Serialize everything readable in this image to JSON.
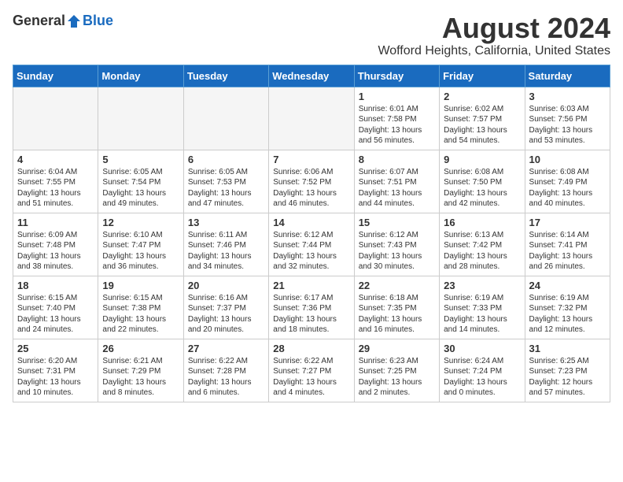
{
  "header": {
    "logo": {
      "general": "General",
      "blue": "Blue"
    },
    "month": "August 2024",
    "location": "Wofford Heights, California, United States"
  },
  "columns": [
    "Sunday",
    "Monday",
    "Tuesday",
    "Wednesday",
    "Thursday",
    "Friday",
    "Saturday"
  ],
  "weeks": [
    [
      {
        "day": "",
        "info": ""
      },
      {
        "day": "",
        "info": ""
      },
      {
        "day": "",
        "info": ""
      },
      {
        "day": "",
        "info": ""
      },
      {
        "day": "1",
        "info": "Sunrise: 6:01 AM\nSunset: 7:58 PM\nDaylight: 13 hours\nand 56 minutes."
      },
      {
        "day": "2",
        "info": "Sunrise: 6:02 AM\nSunset: 7:57 PM\nDaylight: 13 hours\nand 54 minutes."
      },
      {
        "day": "3",
        "info": "Sunrise: 6:03 AM\nSunset: 7:56 PM\nDaylight: 13 hours\nand 53 minutes."
      }
    ],
    [
      {
        "day": "4",
        "info": "Sunrise: 6:04 AM\nSunset: 7:55 PM\nDaylight: 13 hours\nand 51 minutes."
      },
      {
        "day": "5",
        "info": "Sunrise: 6:05 AM\nSunset: 7:54 PM\nDaylight: 13 hours\nand 49 minutes."
      },
      {
        "day": "6",
        "info": "Sunrise: 6:05 AM\nSunset: 7:53 PM\nDaylight: 13 hours\nand 47 minutes."
      },
      {
        "day": "7",
        "info": "Sunrise: 6:06 AM\nSunset: 7:52 PM\nDaylight: 13 hours\nand 46 minutes."
      },
      {
        "day": "8",
        "info": "Sunrise: 6:07 AM\nSunset: 7:51 PM\nDaylight: 13 hours\nand 44 minutes."
      },
      {
        "day": "9",
        "info": "Sunrise: 6:08 AM\nSunset: 7:50 PM\nDaylight: 13 hours\nand 42 minutes."
      },
      {
        "day": "10",
        "info": "Sunrise: 6:08 AM\nSunset: 7:49 PM\nDaylight: 13 hours\nand 40 minutes."
      }
    ],
    [
      {
        "day": "11",
        "info": "Sunrise: 6:09 AM\nSunset: 7:48 PM\nDaylight: 13 hours\nand 38 minutes."
      },
      {
        "day": "12",
        "info": "Sunrise: 6:10 AM\nSunset: 7:47 PM\nDaylight: 13 hours\nand 36 minutes."
      },
      {
        "day": "13",
        "info": "Sunrise: 6:11 AM\nSunset: 7:46 PM\nDaylight: 13 hours\nand 34 minutes."
      },
      {
        "day": "14",
        "info": "Sunrise: 6:12 AM\nSunset: 7:44 PM\nDaylight: 13 hours\nand 32 minutes."
      },
      {
        "day": "15",
        "info": "Sunrise: 6:12 AM\nSunset: 7:43 PM\nDaylight: 13 hours\nand 30 minutes."
      },
      {
        "day": "16",
        "info": "Sunrise: 6:13 AM\nSunset: 7:42 PM\nDaylight: 13 hours\nand 28 minutes."
      },
      {
        "day": "17",
        "info": "Sunrise: 6:14 AM\nSunset: 7:41 PM\nDaylight: 13 hours\nand 26 minutes."
      }
    ],
    [
      {
        "day": "18",
        "info": "Sunrise: 6:15 AM\nSunset: 7:40 PM\nDaylight: 13 hours\nand 24 minutes."
      },
      {
        "day": "19",
        "info": "Sunrise: 6:15 AM\nSunset: 7:38 PM\nDaylight: 13 hours\nand 22 minutes."
      },
      {
        "day": "20",
        "info": "Sunrise: 6:16 AM\nSunset: 7:37 PM\nDaylight: 13 hours\nand 20 minutes."
      },
      {
        "day": "21",
        "info": "Sunrise: 6:17 AM\nSunset: 7:36 PM\nDaylight: 13 hours\nand 18 minutes."
      },
      {
        "day": "22",
        "info": "Sunrise: 6:18 AM\nSunset: 7:35 PM\nDaylight: 13 hours\nand 16 minutes."
      },
      {
        "day": "23",
        "info": "Sunrise: 6:19 AM\nSunset: 7:33 PM\nDaylight: 13 hours\nand 14 minutes."
      },
      {
        "day": "24",
        "info": "Sunrise: 6:19 AM\nSunset: 7:32 PM\nDaylight: 13 hours\nand 12 minutes."
      }
    ],
    [
      {
        "day": "25",
        "info": "Sunrise: 6:20 AM\nSunset: 7:31 PM\nDaylight: 13 hours\nand 10 minutes."
      },
      {
        "day": "26",
        "info": "Sunrise: 6:21 AM\nSunset: 7:29 PM\nDaylight: 13 hours\nand 8 minutes."
      },
      {
        "day": "27",
        "info": "Sunrise: 6:22 AM\nSunset: 7:28 PM\nDaylight: 13 hours\nand 6 minutes."
      },
      {
        "day": "28",
        "info": "Sunrise: 6:22 AM\nSunset: 7:27 PM\nDaylight: 13 hours\nand 4 minutes."
      },
      {
        "day": "29",
        "info": "Sunrise: 6:23 AM\nSunset: 7:25 PM\nDaylight: 13 hours\nand 2 minutes."
      },
      {
        "day": "30",
        "info": "Sunrise: 6:24 AM\nSunset: 7:24 PM\nDaylight: 13 hours\nand 0 minutes."
      },
      {
        "day": "31",
        "info": "Sunrise: 6:25 AM\nSunset: 7:23 PM\nDaylight: 12 hours\nand 57 minutes."
      }
    ]
  ]
}
